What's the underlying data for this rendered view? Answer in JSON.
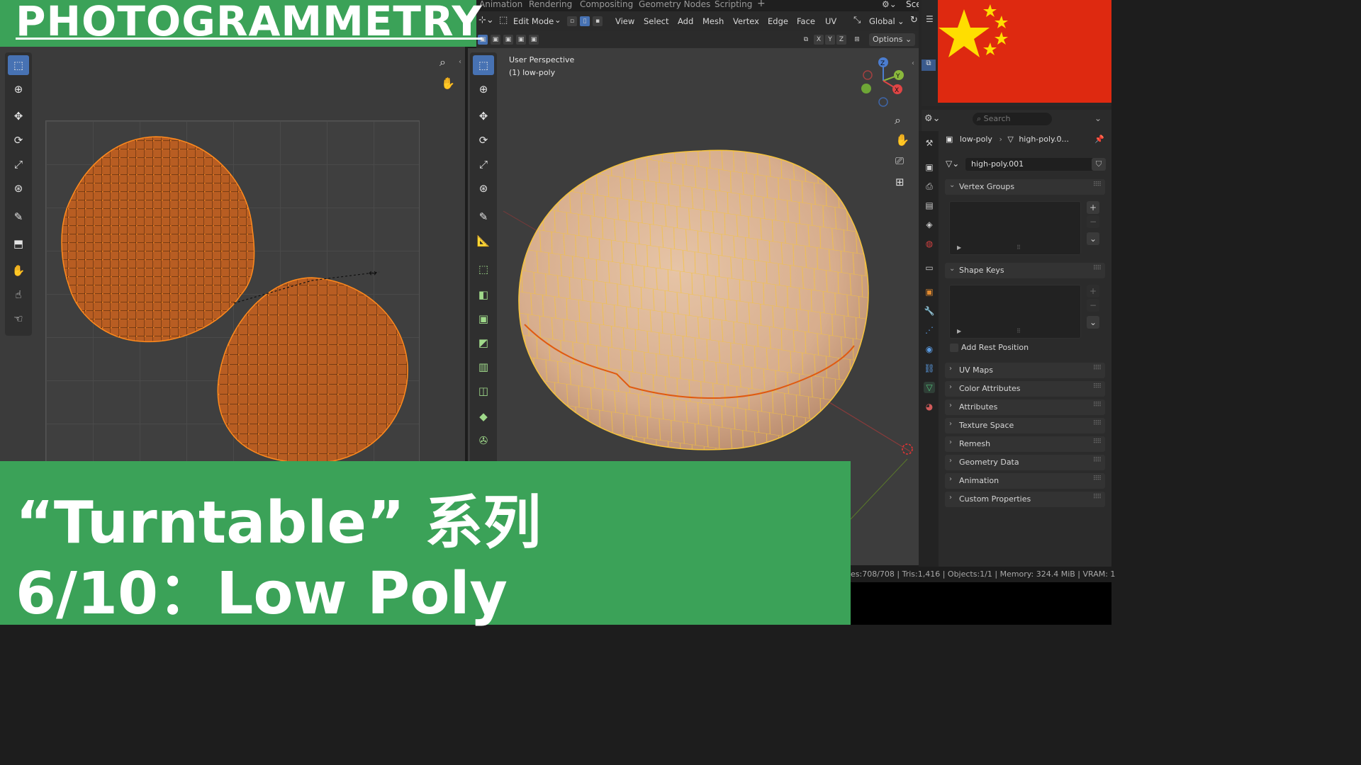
{
  "title_banner": {
    "text": "PHOTOGRAMMETRY"
  },
  "bottom_banner": {
    "line1": "“Turntable” 系列",
    "line2": "6/10：Low Poly"
  },
  "workspace_tabs": [
    "Animation",
    "Rendering",
    "Compositing",
    "Geometry Nodes",
    "Scripting",
    "+"
  ],
  "scene_label": "Scene",
  "header": {
    "mode": "Edit Mode",
    "menus": [
      "View",
      "Select",
      "Add",
      "Mesh",
      "Vertex",
      "Edge",
      "Face",
      "UV"
    ],
    "orientation": "Global",
    "axes": [
      "X",
      "Y",
      "Z"
    ],
    "options": "Options"
  },
  "viewport": {
    "perspective": "User Perspective",
    "object": "(1) low-poly"
  },
  "gizmo": {
    "x": "X",
    "y": "Y",
    "z": "Z"
  },
  "properties": {
    "search_placeholder": "Search",
    "breadcrumb_object": "low-poly",
    "breadcrumb_mesh": "high-poly.0...",
    "mesh_name": "high-poly.001",
    "panels": {
      "vertex_groups": "Vertex Groups",
      "shape_keys": "Shape Keys",
      "add_rest_position": "Add Rest Position",
      "uv_maps": "UV Maps",
      "color_attributes": "Color Attributes",
      "attributes": "Attributes",
      "texture_space": "Texture Space",
      "remesh": "Remesh",
      "geometry_data": "Geometry Data",
      "animation": "Animation",
      "custom_properties": "Custom Properties"
    }
  },
  "status_bar": "es:708/708 | Tris:1,416 | Objects:1/1 | Memory: 324.4 MiB | VRAM: 1",
  "colors": {
    "banner_green": "#3ba258",
    "flag_red": "#de2910",
    "flag_star": "#ffde00",
    "uv_island": "#b85d22",
    "uv_vertex": "#ff8a1c",
    "mesh_fill": "#d8ae8e",
    "wire": "#f5c33d",
    "seam": "#e05a10",
    "active_tool": "#4772b3"
  }
}
